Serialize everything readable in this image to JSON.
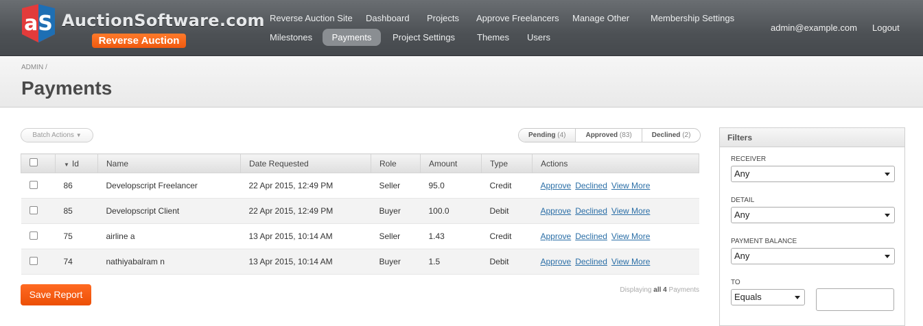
{
  "brand": {
    "name": "AuctionSoftware.com",
    "badge": "Reverse Auction",
    "mark_letters": "aS"
  },
  "nav": {
    "row1": [
      "Reverse Auction Site",
      "Dashboard",
      "Projects",
      "Approve Freelancers",
      "Manage Other",
      "Membership Settings"
    ],
    "row2": [
      "Milestones",
      "Payments",
      "Project Settings",
      "Themes",
      "Users"
    ],
    "active": "Payments"
  },
  "user": {
    "email": "admin@example.com",
    "logout": "Logout"
  },
  "breadcrumb": "ADMIN /",
  "page_title": "Payments",
  "toolbar": {
    "batch_actions": "Batch Actions",
    "scopes": [
      {
        "label": "Pending",
        "count": "(4)"
      },
      {
        "label": "Approved",
        "count": "(83)"
      },
      {
        "label": "Declined",
        "count": "(2)"
      }
    ]
  },
  "table": {
    "columns": [
      "Id",
      "Name",
      "Date Requested",
      "Role",
      "Amount",
      "Type",
      "Actions"
    ],
    "rows": [
      {
        "id": "86",
        "name": "Developscript Freelancer",
        "date": "22 Apr 2015, 12:49 PM",
        "role": "Seller",
        "amount": "95.0",
        "type": "Credit"
      },
      {
        "id": "85",
        "name": "Developscript Client",
        "date": "22 Apr 2015, 12:49 PM",
        "role": "Buyer",
        "amount": "100.0",
        "type": "Debit"
      },
      {
        "id": "75",
        "name": "airline a",
        "date": "13 Apr 2015, 10:14 AM",
        "role": "Seller",
        "amount": "1.43",
        "type": "Credit"
      },
      {
        "id": "74",
        "name": "nathiyabalram n",
        "date": "13 Apr 2015, 10:14 AM",
        "role": "Buyer",
        "amount": "1.5",
        "type": "Debit"
      }
    ],
    "actions": [
      "Approve",
      "Declined",
      "View More"
    ]
  },
  "footer": {
    "save_report": "Save Report",
    "display_prefix": "Displaying",
    "display_count": "all 4",
    "display_suffix": "Payments"
  },
  "filters": {
    "title": "Filters",
    "receiver_label": "RECEIVER",
    "receiver_value": "Any",
    "detail_label": "DETAIL",
    "detail_value": "Any",
    "balance_label": "PAYMENT BALANCE",
    "balance_value": "Any",
    "to_label": "TO",
    "to_value": "Equals"
  },
  "colors": {
    "accent": "#f05a0f",
    "link": "#2a6ea6",
    "header": "#4d5155"
  }
}
